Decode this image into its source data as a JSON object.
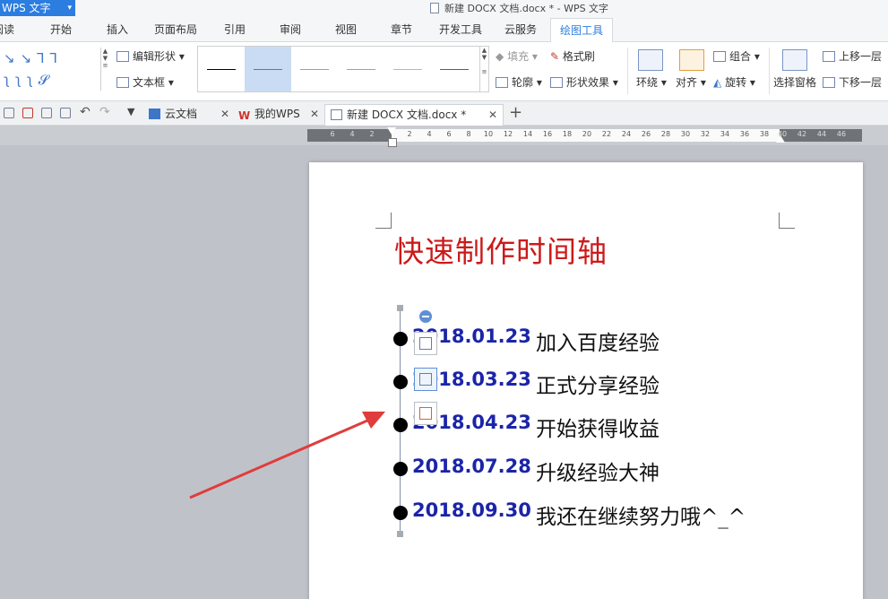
{
  "app": {
    "button_label": "WPS 文字",
    "window_title": "新建 DOCX 文档.docx * - WPS 文字"
  },
  "ribbon_tabs": [
    "阅读",
    "开始",
    "插入",
    "页面布局",
    "引用",
    "审阅",
    "视图",
    "章节",
    "开发工具",
    "云服务",
    "绘图工具"
  ],
  "active_ribbon_tab": "绘图工具",
  "ribbon": {
    "edit_shape": "编辑形状",
    "text_box": "文本框",
    "fill": "填充",
    "format_painter": "格式刷",
    "outline": "轮廓",
    "shape_effects": "形状效果",
    "wrap": "环绕",
    "align": "对齐",
    "group": "组合",
    "rotate": "旋转",
    "selection_pane": "选择窗格",
    "bring_forward": "上移一层",
    "send_backward": "下移一层",
    "line_style_colors": [
      "#000000",
      "#4a7ac8",
      "#c89b3a",
      "#9aa1ab",
      "#e8b838",
      "#3d5f9e"
    ],
    "selected_line_style": 1
  },
  "doc_tabs": [
    {
      "label": "云文档",
      "icon": "cloud-icon"
    },
    {
      "label": "我的WPS",
      "icon": "wps-logo-icon"
    },
    {
      "label": "新建 DOCX 文档.docx *",
      "icon": "document-icon",
      "active": true
    }
  ],
  "ruler": {
    "left_numbers": [
      "6",
      "4",
      "2"
    ],
    "numbers": [
      "2",
      "4",
      "6",
      "8",
      "10",
      "12",
      "14",
      "16",
      "18",
      "20",
      "22",
      "24",
      "26",
      "28",
      "30",
      "32",
      "34",
      "36",
      "38"
    ],
    "right_numbers": [
      "40",
      "42",
      "44",
      "46"
    ]
  },
  "document": {
    "heading": "快速制作时间轴",
    "heading_color": "#cc1a1a",
    "date_color": "#1b24a8",
    "entries": [
      {
        "date": "2018.01.23",
        "text": "加入百度经验"
      },
      {
        "date": "2018.03.23",
        "text": "正式分享经验"
      },
      {
        "date": "2018.04.23",
        "text": "开始获得收益"
      },
      {
        "date": "2018.07.28",
        "text": "升级经验大神"
      },
      {
        "date": "2018.09.30",
        "text": "我还在继续努力哦^_^"
      }
    ]
  },
  "annotation": {
    "arrow_color": "#e03c3c"
  }
}
